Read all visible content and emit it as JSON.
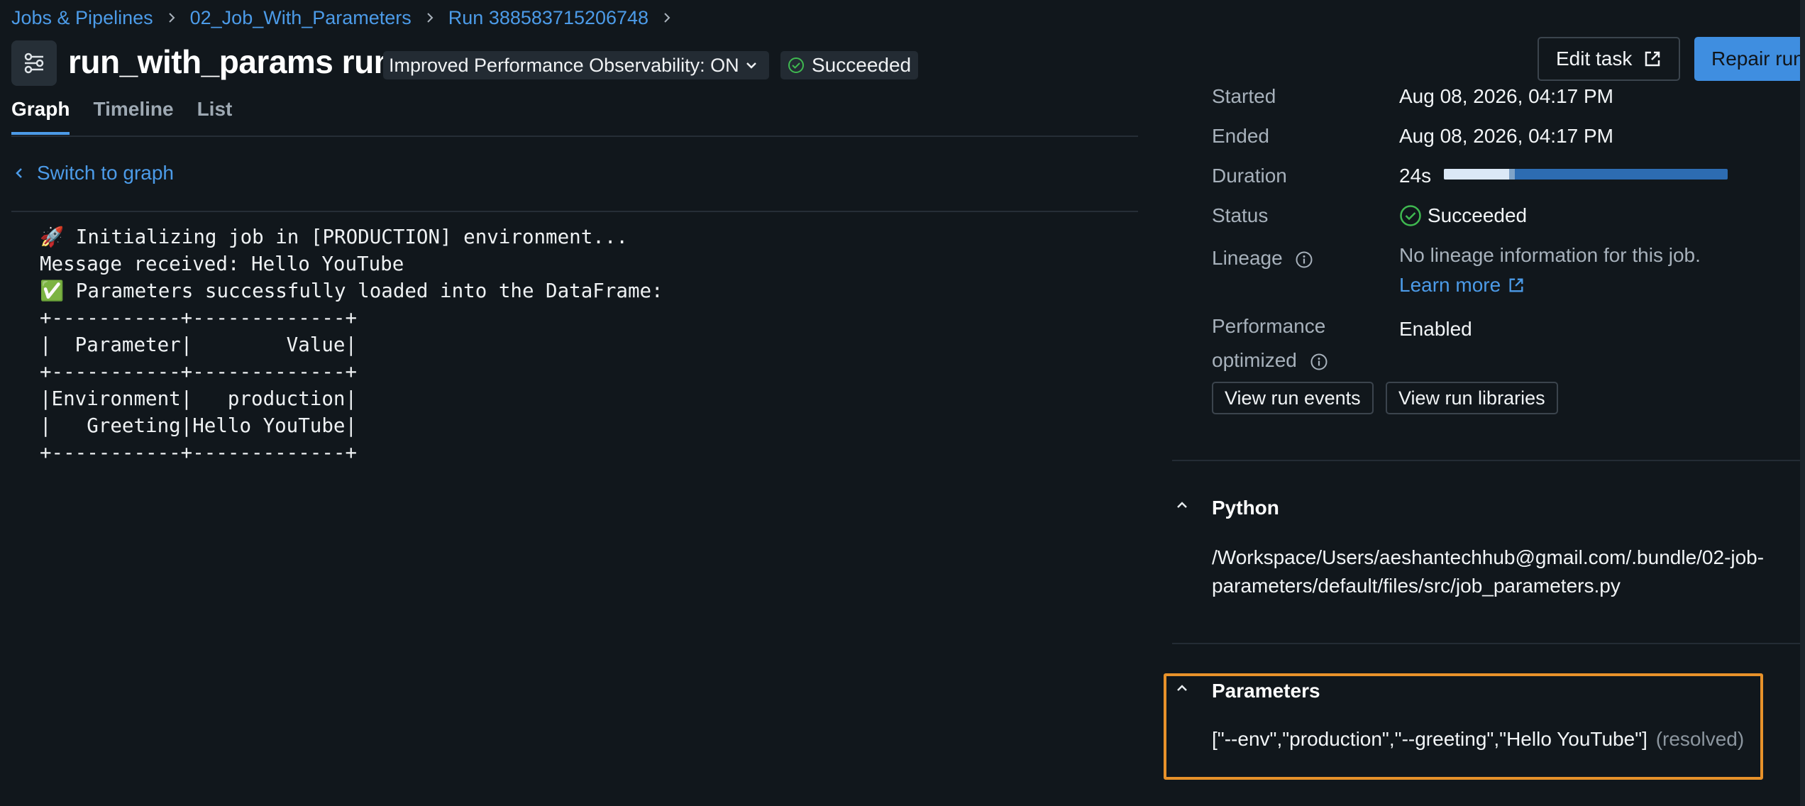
{
  "breadcrumb": {
    "items": [
      "Jobs & Pipelines",
      "02_Job_With_Parameters",
      "Run 388583715206748"
    ]
  },
  "header": {
    "title": "run_with_params run",
    "perf_dropdown": "Improved Performance Observability: ON",
    "status": "Succeeded"
  },
  "tabs": [
    {
      "label": "Graph",
      "active": true
    },
    {
      "label": "Timeline",
      "active": false
    },
    {
      "label": "List",
      "active": false
    }
  ],
  "switch_link": "Switch to graph",
  "output_text": "🚀 Initializing job in [PRODUCTION] environment...\nMessage received: Hello YouTube\n✅ Parameters successfully loaded into the DataFrame:\n+-----------+-------------+\n|  Parameter|        Value|\n+-----------+-------------+\n|Environment|   production|\n|   Greeting|Hello YouTube|\n+-----------+-------------+",
  "actions": {
    "edit_task": "Edit task",
    "repair_run": "Repair run"
  },
  "details": {
    "started_label": "Started",
    "started_value": "Aug 08, 2026, 04:17 PM",
    "ended_label": "Ended",
    "ended_value": "Aug 08, 2026, 04:17 PM",
    "duration_label": "Duration",
    "duration_value": "24s",
    "duration_progress": {
      "phase1_fraction": 0.23,
      "phase2_fraction": 0.02
    },
    "status_label": "Status",
    "status_value": "Succeeded",
    "lineage_label": "Lineage",
    "lineage_text": "No lineage information for this job.",
    "lineage_link": "Learn more",
    "perf_label_line1": "Performance",
    "perf_label_line2": "optimized",
    "perf_value": "Enabled",
    "view_events": "View run events",
    "view_libraries": "View run libraries"
  },
  "python_section": {
    "title": "Python",
    "path": "/Workspace/Users/aeshantechhub@gmail.com/.bundle/02-job-parameters/default/files/src/job_parameters.py"
  },
  "parameters_section": {
    "title": "Parameters",
    "value": "[\"--env\",\"production\",\"--greeting\",\"Hello YouTube\"]",
    "suffix": "(resolved)"
  },
  "colors": {
    "background": "#11171c",
    "link": "#4c9be8",
    "success": "#3fb950",
    "primary_button": "#3f8ee0",
    "highlight_border": "#e8922a"
  }
}
